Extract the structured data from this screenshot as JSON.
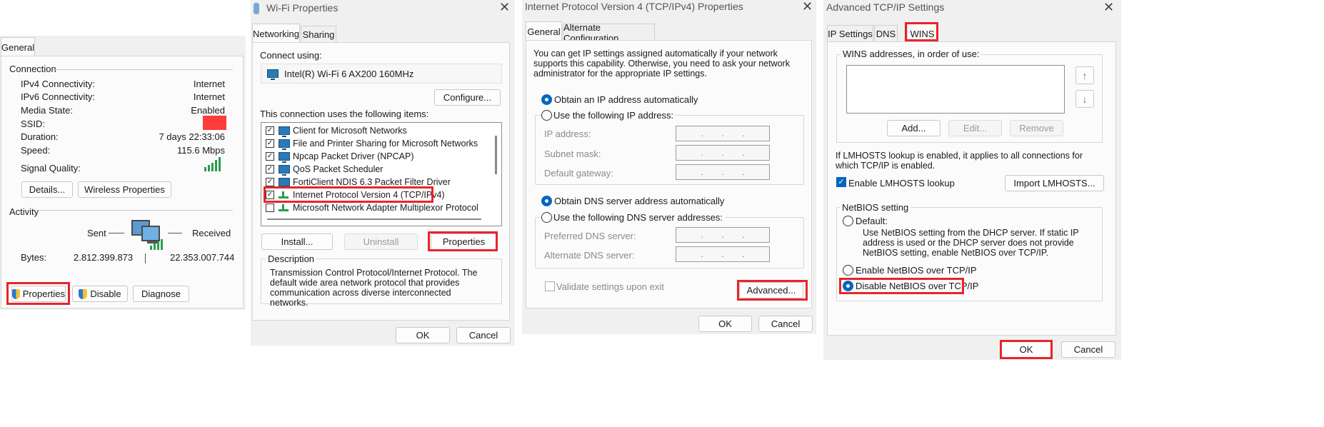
{
  "status": {
    "tab": "General",
    "connection_title": "Connection",
    "rows": [
      {
        "label": "IPv4 Connectivity:",
        "value": "Internet"
      },
      {
        "label": "IPv6 Connectivity:",
        "value": "Internet"
      },
      {
        "label": "Media State:",
        "value": "Enabled"
      },
      {
        "label": "SSID:",
        "value": ""
      },
      {
        "label": "Duration:",
        "value": "7 days 22:33:06"
      },
      {
        "label": "Speed:",
        "value": "115.6 Mbps"
      }
    ],
    "signal_label": "Signal Quality:",
    "signal_level": 1.0,
    "details_btn": "Details...",
    "wireless_btn": "Wireless Properties",
    "activity_title": "Activity",
    "sent": "Sent",
    "received": "Received",
    "bytes_label": "Bytes:",
    "bytes_sent": "2.812.399.873",
    "bytes_received": "22.353.007.744",
    "properties_btn": "Properties",
    "disable_btn": "Disable",
    "diagnose_btn": "Diagnose",
    "redact_color": "#ff3b3b"
  },
  "wifi": {
    "title": "Wi-Fi Properties",
    "tab_networking": "Networking",
    "tab_sharing": "Sharing",
    "connect_using": "Connect using:",
    "adapter": "Intel(R) Wi-Fi 6 AX200 160MHz",
    "configure_btn": "Configure...",
    "items_label": "This connection uses the following items:",
    "items": [
      {
        "label": "Client for Microsoft Networks",
        "checked": true,
        "icon": "network-client-icon"
      },
      {
        "label": "File and Printer Sharing for Microsoft Networks",
        "checked": true,
        "icon": "network-service-icon"
      },
      {
        "label": "Npcap Packet Driver (NPCAP)",
        "checked": true,
        "icon": "network-service-icon"
      },
      {
        "label": "QoS Packet Scheduler",
        "checked": true,
        "icon": "network-service-icon"
      },
      {
        "label": "FortiClient NDIS 6.3 Packet Filter Driver",
        "checked": true,
        "icon": "network-service-icon"
      },
      {
        "label": "Internet Protocol Version 4 (TCP/IPv4)",
        "checked": true,
        "icon": "protocol-icon"
      },
      {
        "label": "Microsoft Network Adapter Multiplexor Protocol",
        "checked": false,
        "icon": "protocol-icon"
      }
    ],
    "install_btn": "Install...",
    "uninstall_btn": "Uninstall",
    "properties_btn": "Properties",
    "description_title": "Description",
    "description": "Transmission Control Protocol/Internet Protocol. The default wide area network protocol that provides communication across diverse interconnected networks.",
    "ok_btn": "OK",
    "cancel_btn": "Cancel"
  },
  "ipv4": {
    "title": "Internet Protocol Version 4 (TCP/IPv4) Properties",
    "tab_general": "General",
    "tab_alt": "Alternate Configuration",
    "intro": "You can get IP settings assigned automatically if your network supports this capability. Otherwise, you need to ask your network administrator for the appropriate IP settings.",
    "obtain_ip_auto": "Obtain an IP address automatically",
    "use_following_ip": "Use the following IP address:",
    "ip_address": "IP address:",
    "subnet_mask": "Subnet mask:",
    "default_gateway": "Default gateway:",
    "obtain_dns_auto": "Obtain DNS server address automatically",
    "use_following_dns": "Use the following DNS server addresses:",
    "preferred_dns": "Preferred DNS server:",
    "alternate_dns": "Alternate DNS server:",
    "validate": "Validate settings upon exit",
    "advanced_btn": "Advanced...",
    "ok_btn": "OK",
    "cancel_btn": "Cancel",
    "ip_dots": [
      ".",
      ".",
      "."
    ]
  },
  "advanced": {
    "title": "Advanced TCP/IP Settings",
    "tab_ip": "IP Settings",
    "tab_dns": "DNS",
    "tab_wins": "WINS",
    "wins_label": "WINS addresses, in order of use:",
    "add_btn": "Add...",
    "edit_btn": "Edit...",
    "remove_btn": "Remove",
    "lmhosts_note": "If LMHOSTS lookup is enabled, it applies to all connections for which TCP/IP is enabled.",
    "enable_lmhosts": "Enable LMHOSTS lookup",
    "import_btn": "Import LMHOSTS...",
    "netbios_title": "NetBIOS setting",
    "default_opt": "Default:",
    "default_desc": "Use NetBIOS setting from the DHCP server. If static IP address is used or the DHCP server does not provide NetBIOS setting, enable NetBIOS over TCP/IP.",
    "enable_netbios": "Enable NetBIOS over TCP/IP",
    "disable_netbios": "Disable NetBIOS over TCP/IP",
    "ok_btn": "OK",
    "cancel_btn": "Cancel"
  },
  "colors": {
    "highlight": "#e8242a",
    "accent": "#0067c0"
  }
}
